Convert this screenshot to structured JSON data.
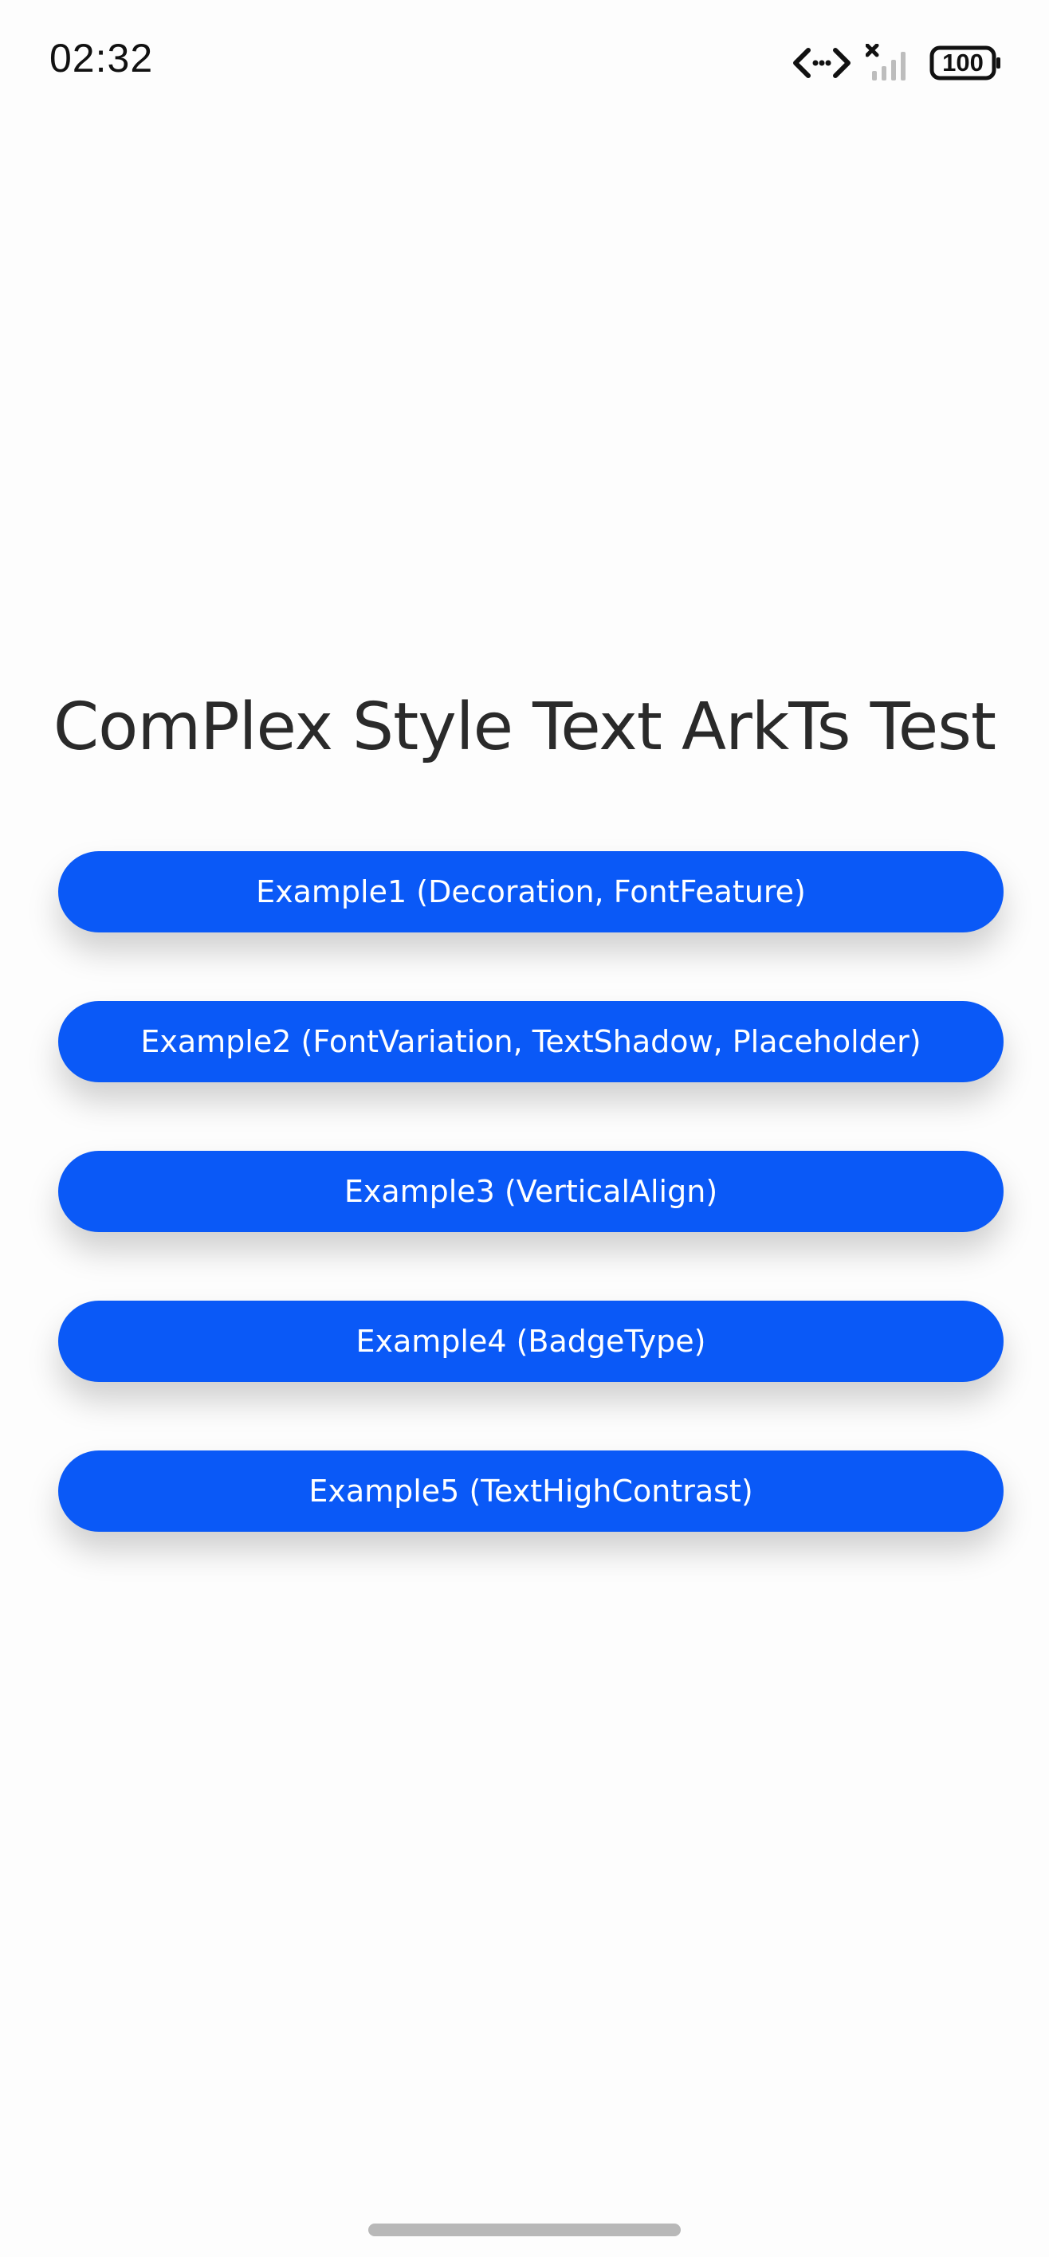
{
  "status_bar": {
    "time": "02:32",
    "battery_level": "100",
    "icons": [
      "data-transfer-icon",
      "signal-no-service-icon",
      "battery-icon"
    ]
  },
  "main": {
    "title": "ComPlex Style Text ArkTs Test",
    "buttons": [
      {
        "label": "Example1 (Decoration, FontFeature)"
      },
      {
        "label": "Example2 (FontVariation, TextShadow, Placeholder)"
      },
      {
        "label": "Example3 (VerticalAlign)"
      },
      {
        "label": "Example4 (BadgeType)"
      },
      {
        "label": "Example5 (TextHighContrast)"
      }
    ]
  },
  "colors": {
    "accent": "#0a59f7",
    "background": "#fdfdfd",
    "title_text": "#2a2a2a"
  }
}
